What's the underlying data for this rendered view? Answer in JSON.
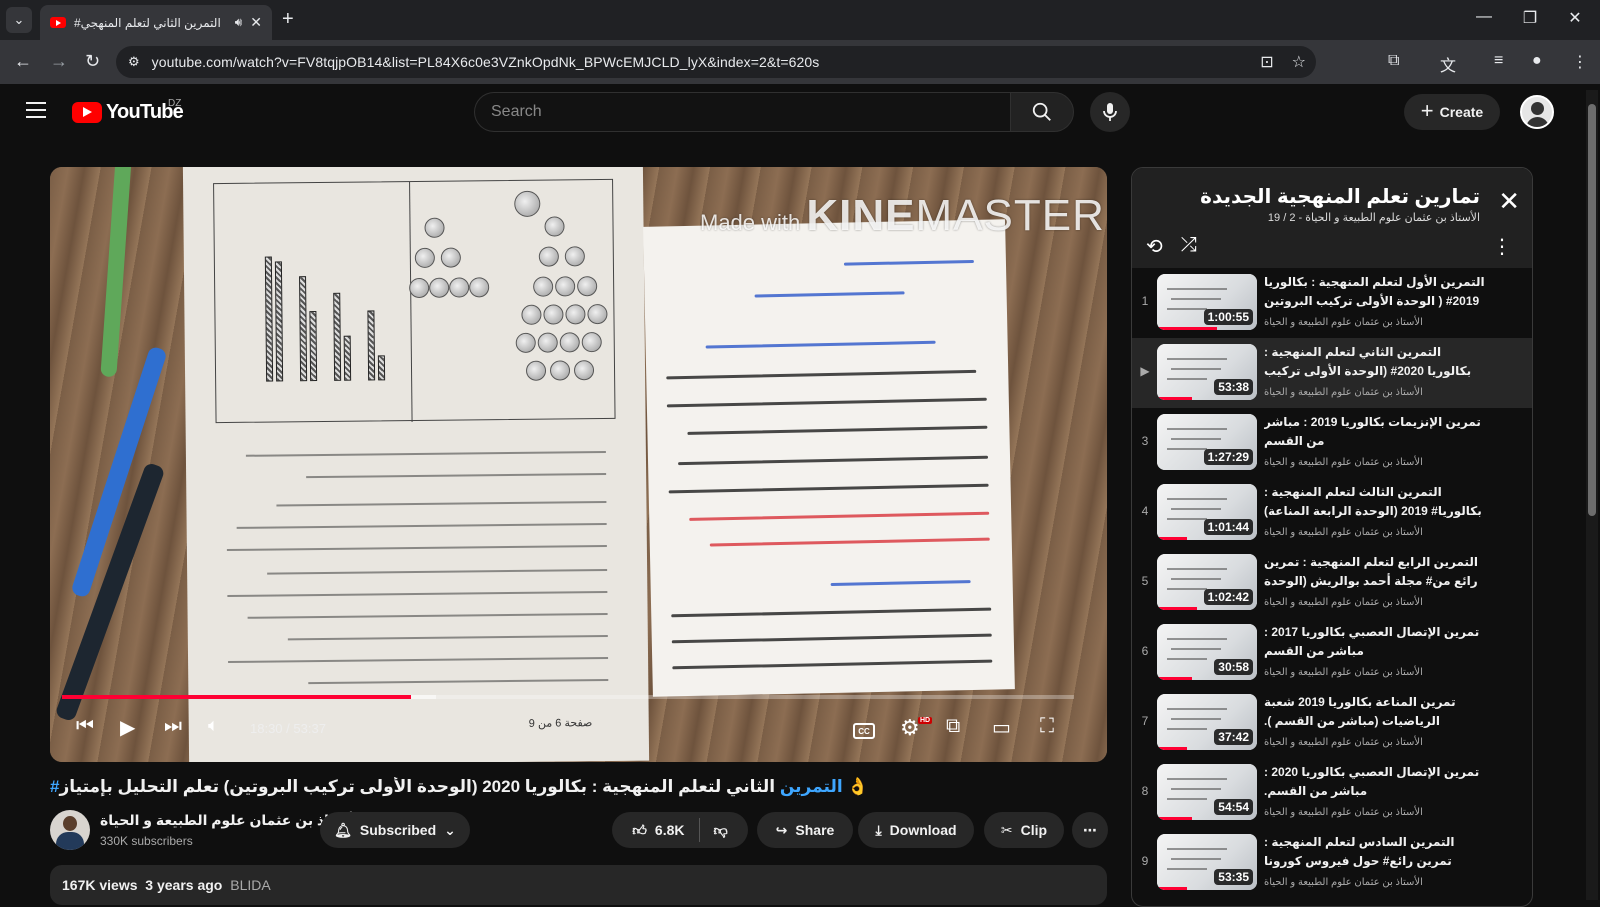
{
  "browser": {
    "tab_title": "التمرين الثاني لتعلم المنهجي#",
    "url": "youtube.com/watch?v=FV8tqjpOB14&list=PL84X6c0e3VZnkOpdNk_BPWcEMJCLD_lyX&index=2&t=620s"
  },
  "header": {
    "logo_text": "YouTube",
    "country_code": "DZ",
    "search_placeholder": "Search",
    "create_label": "Create"
  },
  "player": {
    "watermark_made": "Made with",
    "watermark_kine": "KINE",
    "watermark_master": "MASTER",
    "time_current": "18:30",
    "time_separator": "/",
    "time_total": "53:37",
    "played_fraction": 0.345,
    "buffered_fraction": 0.37,
    "cc_label": "CC",
    "hd_badge": "HD",
    "page_label": "صفحة 6 من 9"
  },
  "video": {
    "title_hashtag": "#التمرين",
    "title_rest": "الثاني لتعلم المنهجية : بكالوريا 2020 (الوحدة الأولى تركيب البروتين) تعلم التحليل بإمتياز 👌",
    "channel_name": "الأستاذ بن عثمان علوم الطبيعة و الحياة",
    "subscribers": "330K subscribers",
    "subscribed_label": "Subscribed",
    "likes": "6.8K",
    "share_label": "Share",
    "download_label": "Download",
    "clip_label": "Clip",
    "views": "167K views",
    "uploaded": "3 years ago",
    "location": "BLIDA"
  },
  "playlist": {
    "title": "تمارين تعلم المنهجية الجديدة",
    "subtitle": "الأستاذ بن عثمان علوم الطبيعة و الحياة - 2 / 19",
    "items": [
      {
        "index": "1",
        "title": "التمرين الأول لتعلم المنهجية : بكالوريا 2019# ( الوحدة الأولى تركيب البروتين )",
        "channel": "الأستاذ بن عثمان علوم الطبيعة و الحياة",
        "duration": "1:00:55",
        "progress": 0.6
      },
      {
        "index": "▶",
        "title": "التمرين الثاني لتعلم المنهجية : بكالوريا 2020# (الوحدة الأولى تركيب البروتين) تعلم التحليل...",
        "channel": "الأستاذ بن عثمان علوم الطبيعة و الحياة",
        "duration": "53:38",
        "progress": 0.35
      },
      {
        "index": "3",
        "title": "تمرين الإنزيمات بكالوريا 2019 : مباشر من القسم",
        "channel": "الأستاذ بن عثمان علوم الطبيعة و الحياة",
        "duration": "1:27:29",
        "progress": 0.0
      },
      {
        "index": "4",
        "title": "التمرين الثالث لتعلم المنهجية : بكالوريا# 2019 (الوحدة الرابعة المناعة) الخلايا...",
        "channel": "الأستاذ بن عثمان علوم الطبيعة و الحياة",
        "duration": "1:01:44",
        "progress": 0.3
      },
      {
        "index": "5",
        "title": "التمرين الرابع لتعلم المنهجية : تمرين رائع من# مجلة أحمد بوالريش (الوحدة الرابعة المناعة) .",
        "channel": "الأستاذ بن عثمان علوم الطبيعة و الحياة",
        "duration": "1:02:42",
        "progress": 0.4
      },
      {
        "index": "6",
        "title": "تمرين الإتصال العصبي بكالوريا 2017 : مباشر من القسم",
        "channel": "الأستاذ بن عثمان علوم الطبيعة و الحياة",
        "duration": "30:58",
        "progress": 0.35
      },
      {
        "index": "7",
        "title": "تمرين المناعة بكالوريا 2019 شعبة الرياضيات (مباشر من القسم ).",
        "channel": "الأستاذ بن عثمان علوم الطبيعة و الحياة",
        "duration": "37:42",
        "progress": 0.3
      },
      {
        "index": "8",
        "title": "تمرين الإتصال العصبي بكالوريا 2020 : مباشر من القسم.",
        "channel": "الأستاذ بن عثمان علوم الطبيعة و الحياة",
        "duration": "54:54",
        "progress": 0.35
      },
      {
        "index": "9",
        "title": "التمرين السادس لتعلم المنهجية : تمرين رائع# حول فيروس كورونا (المناعة) ☢️ ☢️",
        "channel": "الأستاذ بن عثمان علوم الطبيعة و الحياة",
        "duration": "53:35",
        "progress": 0.3
      }
    ]
  }
}
